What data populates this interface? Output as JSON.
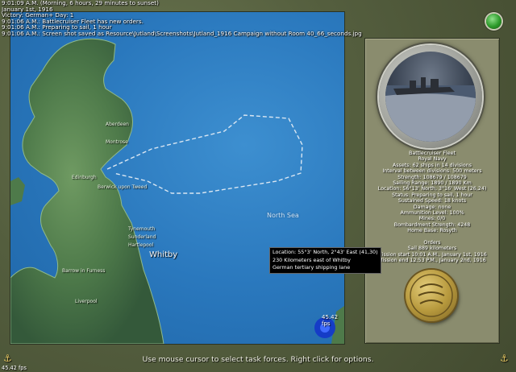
{
  "log_lines": [
    "9:01:09 A.M. (Morning, 6 hours, 29 minutes to sunset)",
    "January 1st, 1916",
    "Victory: German+ Day: 1",
    " 9:01:06 A.M.: Battlecruiser Fleet has new orders.",
    " 9:01:06 A.M.:   Preparing to sail, 1 hour",
    " 9:01:06 A.M.: Screen shot saved as Resource\\Jutland\\Screenshots\\Jutland_1916 Campaign without Room 40_66_seconds.jpg"
  ],
  "map": {
    "sea_label": "North Sea",
    "places": [
      "Aberdeen",
      "Montrose",
      "Edinburgh",
      "Berwick upon Tweed",
      "Tynemouth",
      "Sunderland",
      "Hartlepool",
      "Whitby",
      "Barrow in Furness",
      "Liverpool"
    ],
    "tooltip": [
      "Location: 55°3' North, 2°43' East (41,30)",
      "230 Kilometers east of Whitby",
      "German tertiary shipping lane"
    ],
    "fps": "45.42 fps"
  },
  "panel": {
    "fleet_lines": [
      "Battlecruiser Fleet",
      "Royal Navy",
      "Assets: 62 ships in 14 divisions",
      "Interval between divisions: 500 meters",
      "Strength: 108679 / 108679",
      "Sailing Range: 1890 / 1890 Km",
      "Location: 56°13' North, 3°16' West (26,24)",
      "Status: Preparing to sail, 1 hour",
      "Sustained Speed: 18 knots",
      "Damage: none",
      "Ammunition Level: 100%",
      "Mines: 0/0",
      "Bombardment Strength: 4248",
      "Home Base: Rosyth"
    ],
    "orders_lines": [
      "Orders",
      "Sail 889 kilometers",
      "Mission start 10:01 A.M., January 1st, 1916",
      "Mission end 12:53 P.M., January 2nd, 1916"
    ]
  },
  "status_text": "Use mouse cursor to select task forces. Right click for options.",
  "bottom_fps": "45.42 fps",
  "colors": {
    "sea": "#2a78bd",
    "land": "#4e7a4a",
    "frame": "#545e3e",
    "panel": "#8a8c6e"
  }
}
